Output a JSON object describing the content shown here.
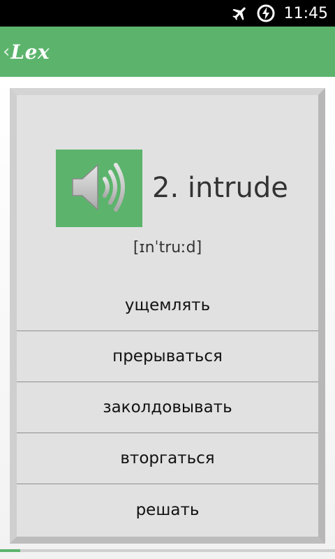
{
  "status_bar": {
    "time": "11:45",
    "icons": [
      "airplane-icon",
      "battery-charging-icon"
    ]
  },
  "action_bar": {
    "up_icon": "chevron-left-icon",
    "app_title": "Lex",
    "accent_color": "#5cb46c"
  },
  "card": {
    "speaker_icon": "speaker-icon",
    "word": "2. intrude",
    "transcription": "[ɪnˈtruːd]",
    "options": [
      {
        "label": "ущемлять"
      },
      {
        "label": "прерываться"
      },
      {
        "label": "заколдовывать"
      },
      {
        "label": "вторгаться"
      },
      {
        "label": "решать"
      }
    ]
  },
  "progress": {
    "fraction": 0.06
  }
}
